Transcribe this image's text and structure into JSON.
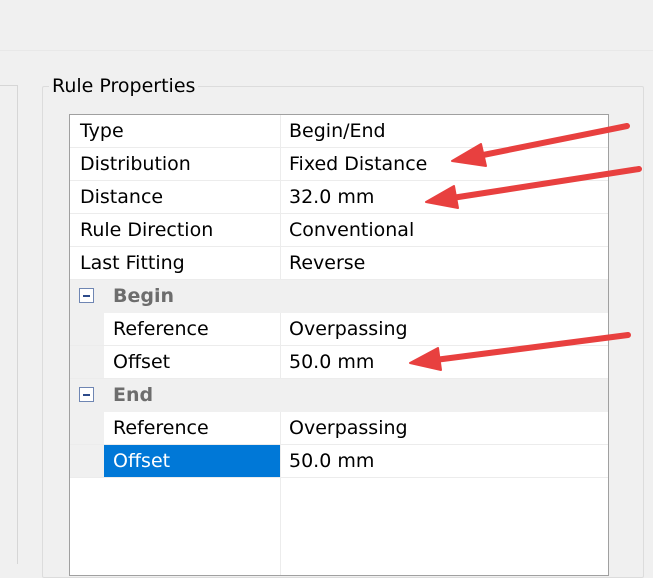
{
  "group": {
    "title": "Rule Properties"
  },
  "rows": [
    {
      "name": "Type",
      "value": "Begin/End"
    },
    {
      "name": "Distribution",
      "value": "Fixed Distance"
    },
    {
      "name": "Distance",
      "value": "32.0 mm"
    },
    {
      "name": "Rule Direction",
      "value": "Conventional"
    },
    {
      "name": "Last Fitting",
      "value": "Reverse"
    }
  ],
  "begin": {
    "label": "Begin",
    "reference": {
      "name": "Reference",
      "value": "Overpassing"
    },
    "offset": {
      "name": "Offset",
      "value": "50.0 mm"
    }
  },
  "end": {
    "label": "End",
    "reference": {
      "name": "Reference",
      "value": "Overpassing"
    },
    "offset": {
      "name": "Offset",
      "value": "50.0 mm"
    }
  },
  "colors": {
    "selection": "#0078d7",
    "annotation_arrow": "#e8403f",
    "category_text": "#6d6d6d"
  },
  "icons": {
    "collapse": "minus-box-icon",
    "annotation": "red-arrow-icon"
  }
}
